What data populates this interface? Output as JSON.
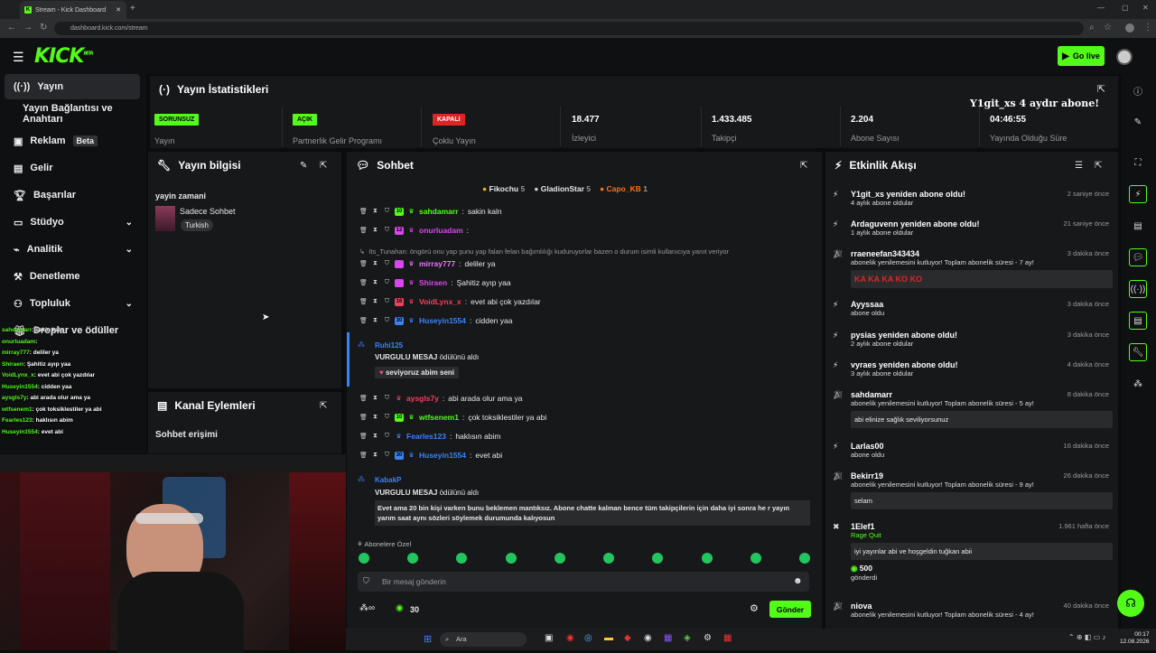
{
  "browser": {
    "tab_title": "Stream - Kick Dashboard",
    "url": "dashboard.kick.com/stream"
  },
  "topbar": {
    "logo": "KICK",
    "logo_beta": "BETA",
    "go_live": "Go live"
  },
  "sidebar": {
    "items": [
      {
        "label": "Yayın"
      },
      {
        "label": "Yayın Bağlantısı ve Anahtarı"
      },
      {
        "label": "Reklam",
        "badge": "Beta"
      },
      {
        "label": "Gelir"
      },
      {
        "label": "Başarılar"
      },
      {
        "label": "Stüdyo"
      },
      {
        "label": "Analitik"
      },
      {
        "label": "Denetleme"
      },
      {
        "label": "Topluluk"
      },
      {
        "label": "Droplar ve ödüller"
      }
    ]
  },
  "stats": {
    "title": "Yayın İstatistikleri",
    "items": [
      {
        "badge": "SORUNSUZ",
        "label": "Yayın"
      },
      {
        "badge": "AÇIK",
        "label": "Partnerlik Gelir Programı"
      },
      {
        "badge": "KAPALI",
        "label": "Çoklu Yayın"
      },
      {
        "value": "18.477",
        "label": "İzleyici"
      },
      {
        "value": "1.433.485",
        "label": "Takipçi"
      },
      {
        "value": "2.204",
        "label": "Abone Sayısı"
      },
      {
        "value": "04:46:55",
        "label": "Yayında Olduğu Süre"
      }
    ],
    "overlay_text": "Y1git_xs 4 aydır abone!"
  },
  "stream_info": {
    "title": "Yayın bilgisi",
    "stream_title": "yayin zamani",
    "category": "Sadece Sohbet",
    "tag": "Turkish"
  },
  "channel_actions": {
    "title": "Kanal Eylemleri",
    "chat_access": "Sohbet erişimi"
  },
  "chat": {
    "title": "Sohbet",
    "top_gifters": [
      {
        "name": "Fikochu",
        "count": "5"
      },
      {
        "name": "GladionStar",
        "count": "5"
      },
      {
        "name": "Capo_KB",
        "count": "1"
      }
    ],
    "messages": [
      {
        "user": "sahdamarr",
        "text": "sakin kaln",
        "color": "#53fc18",
        "lvl": "10"
      },
      {
        "user": "onurluadam",
        "text": "",
        "color": "#d946ef",
        "lvl": "12"
      },
      {
        "reply": "Its_Tunahan: öngörü onu yap şunu yap falan felan bağımlılığı kuduruyorlar bazen o durum isimli kullanıcıya yanıt veriyor"
      },
      {
        "user": "mirray777",
        "text": "deliler ya",
        "color": "#e879f9"
      },
      {
        "user": "Shiraen",
        "text": "Şahitiz ayıp yaa",
        "color": "#d946ef"
      },
      {
        "user": "VoidLynx_x",
        "text": "evet abi çok yazdılar",
        "color": "#f43f5e",
        "lvl": "16"
      },
      {
        "user": "Huseyin1554",
        "text": "cidden yaa",
        "color": "#3b82f6",
        "lvl": "30"
      }
    ],
    "highlight1": {
      "user": "Ruhi125",
      "label": "VURGULU MESAJ",
      "suffix": "ödülünü aldı",
      "text": "seviyoruz abim seni"
    },
    "messages2": [
      {
        "user": "aysgls7y",
        "text": "abi arada olur ama ya",
        "color": "#f43f5e"
      },
      {
        "user": "wtfsenem1",
        "text": "çok toksiklestiler ya abi",
        "color": "#53fc18",
        "lvl": "10"
      },
      {
        "user": "Fearles123",
        "text": "haklısın abim",
        "color": "#3b82f6"
      },
      {
        "user": "Huseyin1554",
        "text": "evet abi",
        "color": "#3b82f6",
        "lvl": "30"
      }
    ],
    "highlight2": {
      "user": "KabakP",
      "label": "VURGULU MESAJ",
      "suffix": "ödülünü aldı",
      "text": "Evet ama 20 bin kişi varken bunu beklemen mantıksız. Abone chatte kalman bence tüm takipçilerin için daha iyi sonra he r yayın yarım saat aynı sözleri söylemek durumunda kalıyosun"
    },
    "emote_label": "Abonelere Özel",
    "placeholder": "Bir mesaj gönderin",
    "points": "30",
    "send": "Gönder"
  },
  "activity": {
    "title": "Etkinlik Akışı",
    "items": [
      {
        "title": "Y1git_xs yeniden abone oldu!",
        "sub": "4 aylık abone oldular",
        "time": "2 saniye önce"
      },
      {
        "title": "Ardaguvenn yeniden abone oldu!",
        "sub": "1 aylık abone oldular",
        "time": "21 saniye önce"
      },
      {
        "title": "rraeneefan343434",
        "sub": "abonelik yenilemesini kutluyor! Toplam abonelik süresi - 7 ay!",
        "time": "3 dakika önce",
        "box": "KA KA KA KO KO"
      },
      {
        "title": "Ayyssaa",
        "sub": "abone oldu",
        "time": "3 dakika önce"
      },
      {
        "title": "pysias yeniden abone oldu!",
        "sub": "2 aylık abone oldular",
        "time": "3 dakika önce"
      },
      {
        "title": "vyraes yeniden abone oldu!",
        "sub": "3 aylık abone oldular",
        "time": "4 dakika önce"
      },
      {
        "title": "sahdamarr",
        "sub": "abonelik yenilemesini kutluyor! Toplam abonelik süresi - 5 ay!",
        "time": "8 dakika önce",
        "box": "abi elinize sağlık seviliyorsunuz"
      },
      {
        "title": "Larlas00",
        "sub": "abone oldu",
        "time": "16 dakika önce"
      },
      {
        "title": "Bekirr19",
        "sub": "abonelik yenilemesini kutluyor! Toplam abonelik süresi - 9 ay!",
        "time": "26 dakika önce",
        "box": "selam"
      },
      {
        "title": "1Elef1",
        "sub": "Rage Quit",
        "time": "1.961 hafta önce",
        "box": "iyi yayınlar abi ve hoşgeldin tuğkan abii",
        "amount": "500",
        "extra": "gönderdi"
      },
      {
        "title": "niova",
        "sub": "abonelik yenilemesini kutluyor! Toplam abonelik süresi - 4 ay!",
        "time": "40 dakika önce"
      }
    ]
  },
  "overlay_chat": [
    {
      "user": "sahdamarr",
      "text": "sakin kaln"
    },
    {
      "user": "onurluadam",
      "text": ""
    },
    {
      "user": "mirray777",
      "text": "deliler ya"
    },
    {
      "user": "Shiraen",
      "text": "Şahitiz ayıp yaa"
    },
    {
      "user": "VoidLynx_x",
      "text": "evet abi çok yazdılar"
    },
    {
      "user": "Huseyin1554",
      "text": "cidden yaa"
    },
    {
      "user": "aysgls7y",
      "text": "abi arada olur ama ya"
    },
    {
      "user": "wtfsenem1",
      "text": "çok toksiklestiler ya abi"
    },
    {
      "user": "Fearles123",
      "text": "haklısın abim"
    },
    {
      "user": "Huseyin1554",
      "text": "evet abi"
    }
  ],
  "taskbar": {
    "search": "Ara",
    "time": "00:17",
    "date": "12.08.2026"
  }
}
